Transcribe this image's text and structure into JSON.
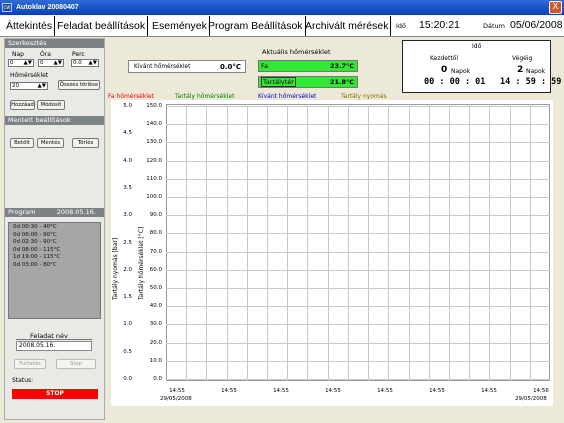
{
  "window": {
    "title": "Autoklav 20080407",
    "icon_label": "CW",
    "close_glyph": "X"
  },
  "tabs": [
    {
      "label": "Áttekintés"
    },
    {
      "label": "Feladat beállítások"
    },
    {
      "label": "Események"
    },
    {
      "label": "Program Beállítások"
    },
    {
      "label": "Archivált mérések"
    }
  ],
  "header": {
    "ido_label": "Idő",
    "time": "15:20:21",
    "datum_label": "Dátum",
    "date": "05/06/2008"
  },
  "szerkesztes": {
    "title": "Szerkesztés",
    "nap_label": "Nap",
    "nap_value": "0",
    "ora_label": "Óra",
    "ora_value": "0",
    "perc_label": "Perc",
    "perc_value": "0.0",
    "homerseklet_label": "Hőmérséklet",
    "homerseklet_value": "20",
    "osszes_torlese": "Összes törlése",
    "hozzaad": "Hozzáad",
    "modosit": "Módosít"
  },
  "mentett": {
    "title": "Mentett beállítások",
    "betolt": "Betölt",
    "mentes": "Mentés",
    "torles": "Törlés"
  },
  "program": {
    "title": "Program",
    "date": "2008.05.16.",
    "items": [
      "0d 00:30 - 40°C",
      "0d 06:00 - 90°C",
      "0d 02:30 - 90°C",
      "0d 08:00 - 115°C",
      "1d 19:00 - 115°C",
      "0d 03:00 - 80°C"
    ]
  },
  "feladat": {
    "label": "Feladat név",
    "value": "2008.05.16.",
    "futtatas": "Futtatás",
    "stop": "Stop",
    "status_label": "Status:",
    "status_value": "STOP"
  },
  "kivant": {
    "label": "Kívánt hőmérséklet",
    "value": "0.0°C"
  },
  "aktualis": {
    "title": "Aktuális hőmérséklet",
    "fa_label": "Fa",
    "fa_value": "23.7°C",
    "tartaly_label": "Tartálytér",
    "tartaly_value": "21.8°C"
  },
  "ido_box": {
    "title": "Idő",
    "kezdettol": "Kezdettől",
    "vegeig": "Végéig",
    "k_days": "0",
    "v_days": "2",
    "napok": "Napok",
    "k_time": "00 : 00 : 01",
    "v_time": "14 : 59 : 59"
  },
  "legend": [
    {
      "name": "Fa hőmérséklet",
      "color": "#ff0000"
    },
    {
      "name": "Tartály hőmérséklet",
      "color": "#007a00"
    },
    {
      "name": "Kívánt hőmérséklet",
      "color": "#0000cc"
    },
    {
      "name": "Tartály nyomás",
      "color": "#8a6a00"
    }
  ],
  "chart_data": {
    "type": "line",
    "series": [],
    "y_left_label": "Tartály nyomás [bar]",
    "y_right_label": "Tartály hőmérséklet [°C]",
    "pressure_ticks": [
      "5.0",
      "4.5",
      "4.0",
      "3.5",
      "3.0",
      "2.5",
      "2.0",
      "1.5",
      "1.0",
      "0.5",
      "0.0"
    ],
    "temp_ticks": [
      "150.0",
      "140.0",
      "130.0",
      "120.0",
      "110.0",
      "100.0",
      "90.0",
      "80.0",
      "70.0",
      "60.0",
      "50.0",
      "40.0",
      "30.0",
      "20.0",
      "10.0",
      "0.0"
    ],
    "x_ticks": [
      "14:55",
      "14:55",
      "14:55",
      "14:55",
      "14:55",
      "14:55",
      "14:55",
      "14:56"
    ],
    "x_dates": [
      "29/05/2008",
      "29/05/2008"
    ],
    "ylim_pressure": [
      0,
      5
    ],
    "ylim_temp": [
      0,
      150
    ],
    "grid": true
  }
}
